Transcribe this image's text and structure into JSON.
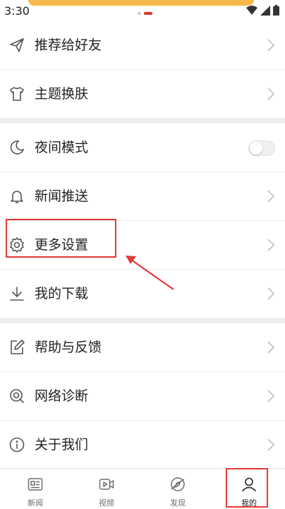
{
  "status_bar": {
    "time": "3:30"
  },
  "menu": {
    "items": [
      {
        "label": "推荐给好友",
        "icon": "send-icon"
      },
      {
        "label": "主题换肤",
        "icon": "tshirt-icon"
      },
      {
        "label": "夜间模式",
        "icon": "moon-icon",
        "toggle": false
      },
      {
        "label": "新闻推送",
        "icon": "bell-icon"
      },
      {
        "label": "更多设置",
        "icon": "gear-icon"
      },
      {
        "label": "我的下载",
        "icon": "download-icon"
      },
      {
        "label": "帮助与反馈",
        "icon": "edit-icon"
      },
      {
        "label": "网络诊断",
        "icon": "network-diagnose-icon"
      },
      {
        "label": "关于我们",
        "icon": "info-icon"
      }
    ]
  },
  "tabbar": {
    "tabs": [
      {
        "label": "新闻",
        "icon": "news-icon"
      },
      {
        "label": "视频",
        "icon": "video-icon"
      },
      {
        "label": "发现",
        "icon": "discover-icon"
      },
      {
        "label": "我的",
        "icon": "profile-icon",
        "active": true
      }
    ]
  },
  "colors": {
    "annotation": "#e53935",
    "accent": "#e0322b",
    "text": "#222222",
    "icon_gray": "#555555",
    "divider": "#eeeeee"
  }
}
